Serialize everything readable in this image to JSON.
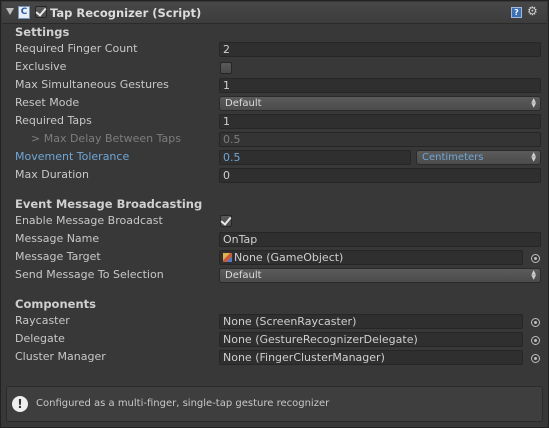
{
  "header": {
    "title": "Tap Recognizer (Script)",
    "enabled": true,
    "script_icon": "script-icon",
    "help_icon": "help-icon",
    "gear_icon": "gear-icon"
  },
  "settings": {
    "heading": "Settings",
    "required_finger_count": {
      "label": "Required Finger Count",
      "value": "2"
    },
    "exclusive": {
      "label": "Exclusive",
      "checked": false
    },
    "max_simultaneous_gestures": {
      "label": "Max Simultaneous Gestures",
      "value": "1"
    },
    "reset_mode": {
      "label": "Reset Mode",
      "value": "Default"
    },
    "required_taps": {
      "label": "Required Taps",
      "value": "1"
    },
    "max_delay_between_taps": {
      "label": "> Max Delay Between Taps",
      "value": "0.5"
    },
    "movement_tolerance": {
      "label": "Movement Tolerance",
      "value": "0.5",
      "unit": "Centimeters"
    },
    "max_duration": {
      "label": "Max Duration",
      "value": "0"
    }
  },
  "broadcasting": {
    "heading": "Event Message Broadcasting",
    "enable_message_broadcast": {
      "label": "Enable Message Broadcast",
      "checked": true
    },
    "message_name": {
      "label": "Message Name",
      "value": "OnTap"
    },
    "message_target": {
      "label": "Message Target",
      "value": "None (GameObject)"
    },
    "send_message_to_selection": {
      "label": "Send Message To Selection",
      "value": "Default"
    }
  },
  "components": {
    "heading": "Components",
    "raycaster": {
      "label": "Raycaster",
      "value": "None (ScreenRaycaster)"
    },
    "delegate": {
      "label": "Delegate",
      "value": "None (GestureRecognizerDelegate)"
    },
    "cluster_manager": {
      "label": "Cluster Manager",
      "value": "None (FingerClusterManager)"
    }
  },
  "info": {
    "icon": "info-icon",
    "text": "Configured as a multi-finger, single-tap gesture recognizer"
  },
  "colors": {
    "background": "#383838",
    "field": "#2f2f2f",
    "modified_label": "#6fa6d6",
    "text": "#c8c8c8"
  }
}
